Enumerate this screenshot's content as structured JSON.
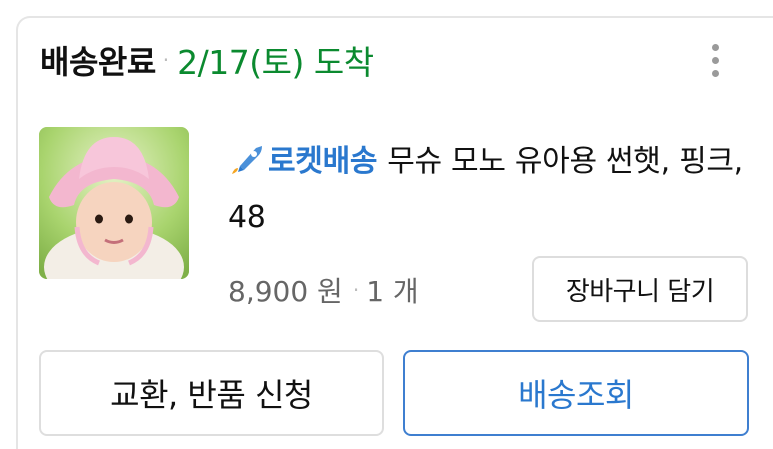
{
  "order": {
    "status_label": "배송완료",
    "separator": "·",
    "arrival_text": "2/17(토) 도착",
    "menu_icon": "more-vertical-icon"
  },
  "product": {
    "image_icon": "baby-sun-hat-photo",
    "badge_icon": "rocket-icon",
    "badge_label": "로켓배송",
    "name": "무슈 모노 유아용 썬햇, 핑크, 48",
    "price": "8,900 원",
    "separator": "·",
    "quantity": "1 개",
    "add_to_cart_label": "장바구니 담기"
  },
  "actions": {
    "return_label": "교환, 반품 신청",
    "tracking_label": "배송조회"
  },
  "colors": {
    "delivered_green": "#0b8a2f",
    "rocket_blue": "#2a78ce",
    "border_gray": "#dddddd"
  }
}
